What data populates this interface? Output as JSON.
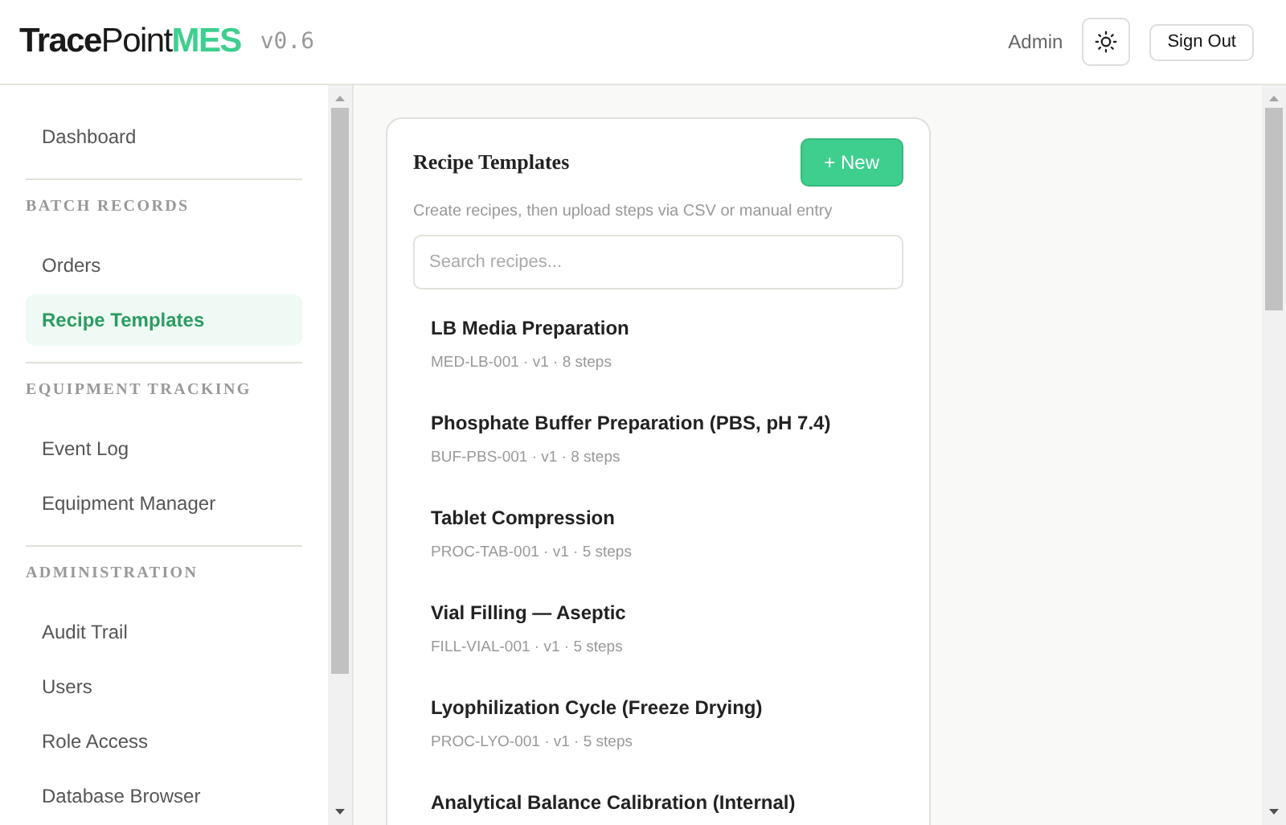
{
  "header": {
    "brand": [
      {
        "text": "Trace",
        "kind": "bold"
      },
      {
        "text": "Point",
        "kind": "plain"
      },
      {
        "text": "MES",
        "kind": "accent"
      }
    ],
    "version": "v0.6",
    "user": "Admin",
    "sign_out": "Sign Out"
  },
  "sidebar": {
    "sections": [
      {
        "items": [
          {
            "label": "Dashboard",
            "selected": false
          }
        ]
      },
      {
        "heading": "BATCH RECORDS",
        "items": [
          {
            "label": "Orders",
            "selected": false
          },
          {
            "label": "Recipe Templates",
            "selected": true
          }
        ]
      },
      {
        "heading": "EQUIPMENT TRACKING",
        "items": [
          {
            "label": "Event Log",
            "selected": false
          },
          {
            "label": "Equipment Manager",
            "selected": false
          }
        ]
      },
      {
        "heading": "ADMINISTRATION",
        "items": [
          {
            "label": "Audit Trail",
            "selected": false
          },
          {
            "label": "Users",
            "selected": false
          },
          {
            "label": "Role Access",
            "selected": false
          },
          {
            "label": "Database Browser",
            "selected": false
          }
        ]
      }
    ]
  },
  "card": {
    "title": "Recipe Templates",
    "new_button": "+ New",
    "subtitle": "Create recipes, then upload steps via CSV or manual entry",
    "search": {
      "placeholder": "Search recipes..."
    },
    "recipes": [
      {
        "name": "LB Media Preparation",
        "meta": "MED-LB-001 · v1 · 8 steps"
      },
      {
        "name": "Phosphate Buffer Preparation (PBS, pH 7.4)",
        "meta": "BUF-PBS-001 · v1 · 8 steps"
      },
      {
        "name": "Tablet Compression",
        "meta": "PROC-TAB-001 · v1 · 5 steps"
      },
      {
        "name": "Vial Filling — Aseptic",
        "meta": "FILL-VIAL-001 · v1 · 5 steps"
      },
      {
        "name": "Lyophilization Cycle (Freeze Drying)",
        "meta": "PROC-LYO-001 · v1 · 5 steps"
      },
      {
        "name": "Analytical Balance Calibration (Internal)"
      }
    ]
  }
}
